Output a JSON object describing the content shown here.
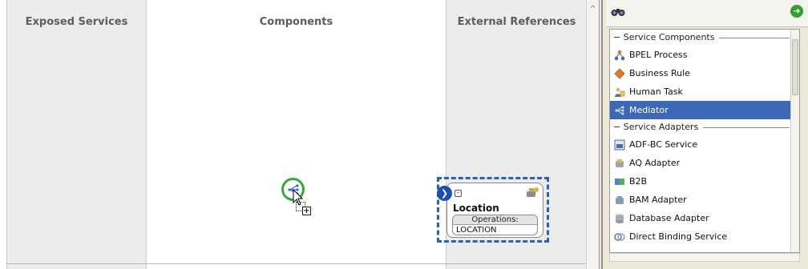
{
  "editor": {
    "swimlanes": {
      "exposed_services": "Exposed Services",
      "components": "Components",
      "external_references": "External References"
    },
    "reference": {
      "name": "Location",
      "operations_header": "Operations:",
      "operations": [
        "LOCATION"
      ]
    },
    "dragged_component_icon": "mediator-icon"
  },
  "palette": {
    "sections": [
      {
        "title": "Service Components",
        "items": [
          {
            "label": "BPEL Process",
            "icon": "bpel-process-icon"
          },
          {
            "label": "Business Rule",
            "icon": "business-rule-icon"
          },
          {
            "label": "Human Task",
            "icon": "human-task-icon"
          },
          {
            "label": "Mediator",
            "icon": "mediator-icon",
            "selected": true
          }
        ]
      },
      {
        "title": "Service Adapters",
        "items": [
          {
            "label": "ADF-BC Service",
            "icon": "adf-bc-service-icon"
          },
          {
            "label": "AQ Adapter",
            "icon": "aq-adapter-icon"
          },
          {
            "label": "B2B",
            "icon": "b2b-icon"
          },
          {
            "label": "BAM Adapter",
            "icon": "bam-adapter-icon"
          },
          {
            "label": "Database Adapter",
            "icon": "database-adapter-icon"
          },
          {
            "label": "Direct Binding Service",
            "icon": "direct-binding-service-icon"
          }
        ]
      }
    ]
  },
  "colors": {
    "selection": "#3d68b5",
    "selection_border": "#2b61b6",
    "drag_ring": "#3aa53a",
    "swimlane_side": "#ececec"
  }
}
